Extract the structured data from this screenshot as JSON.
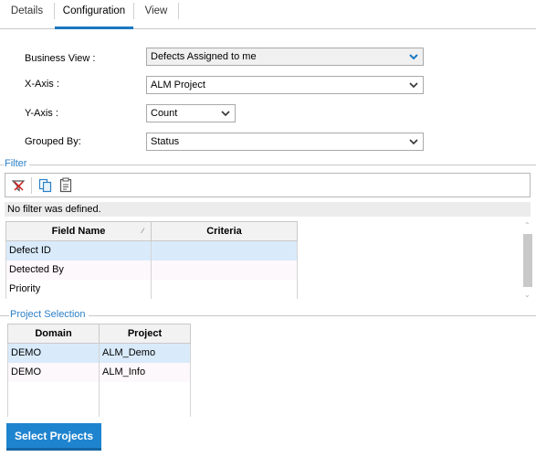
{
  "tabs": [
    {
      "label": "Details",
      "active": false
    },
    {
      "label": "Configuration",
      "active": true
    },
    {
      "label": "View",
      "active": false
    }
  ],
  "form": {
    "business_view": {
      "label": "Business View :",
      "value": "Defects Assigned to me"
    },
    "x_axis": {
      "label": "X-Axis :",
      "value": "ALM Project"
    },
    "y_axis": {
      "label": "Y-Axis :",
      "value": "Count"
    },
    "grouped_by": {
      "label": "Grouped By:",
      "value": "Status"
    }
  },
  "filter": {
    "section_title": "Filter",
    "toolbar_icons": [
      "filter-icon",
      "copy-icon",
      "paste-icon"
    ],
    "no_filter_text": "No filter was defined.",
    "columns": [
      "Field Name",
      "Criteria"
    ],
    "rows": [
      {
        "field": "Defect ID",
        "criteria": ""
      },
      {
        "field": "Detected By",
        "criteria": ""
      },
      {
        "field": "Priority",
        "criteria": ""
      }
    ]
  },
  "project_selection": {
    "section_title": "Project Selection",
    "columns": [
      "Domain",
      "Project"
    ],
    "rows": [
      {
        "domain": "DEMO",
        "project": "ALM_Demo"
      },
      {
        "domain": "DEMO",
        "project": "ALM_Info"
      }
    ],
    "button_label": "Select Projects"
  },
  "colors": {
    "accent": "#1a78c2",
    "section_title": "#2b7fc6",
    "button_bg": "#1f84cf",
    "selected_row": "#d9ebfb"
  }
}
